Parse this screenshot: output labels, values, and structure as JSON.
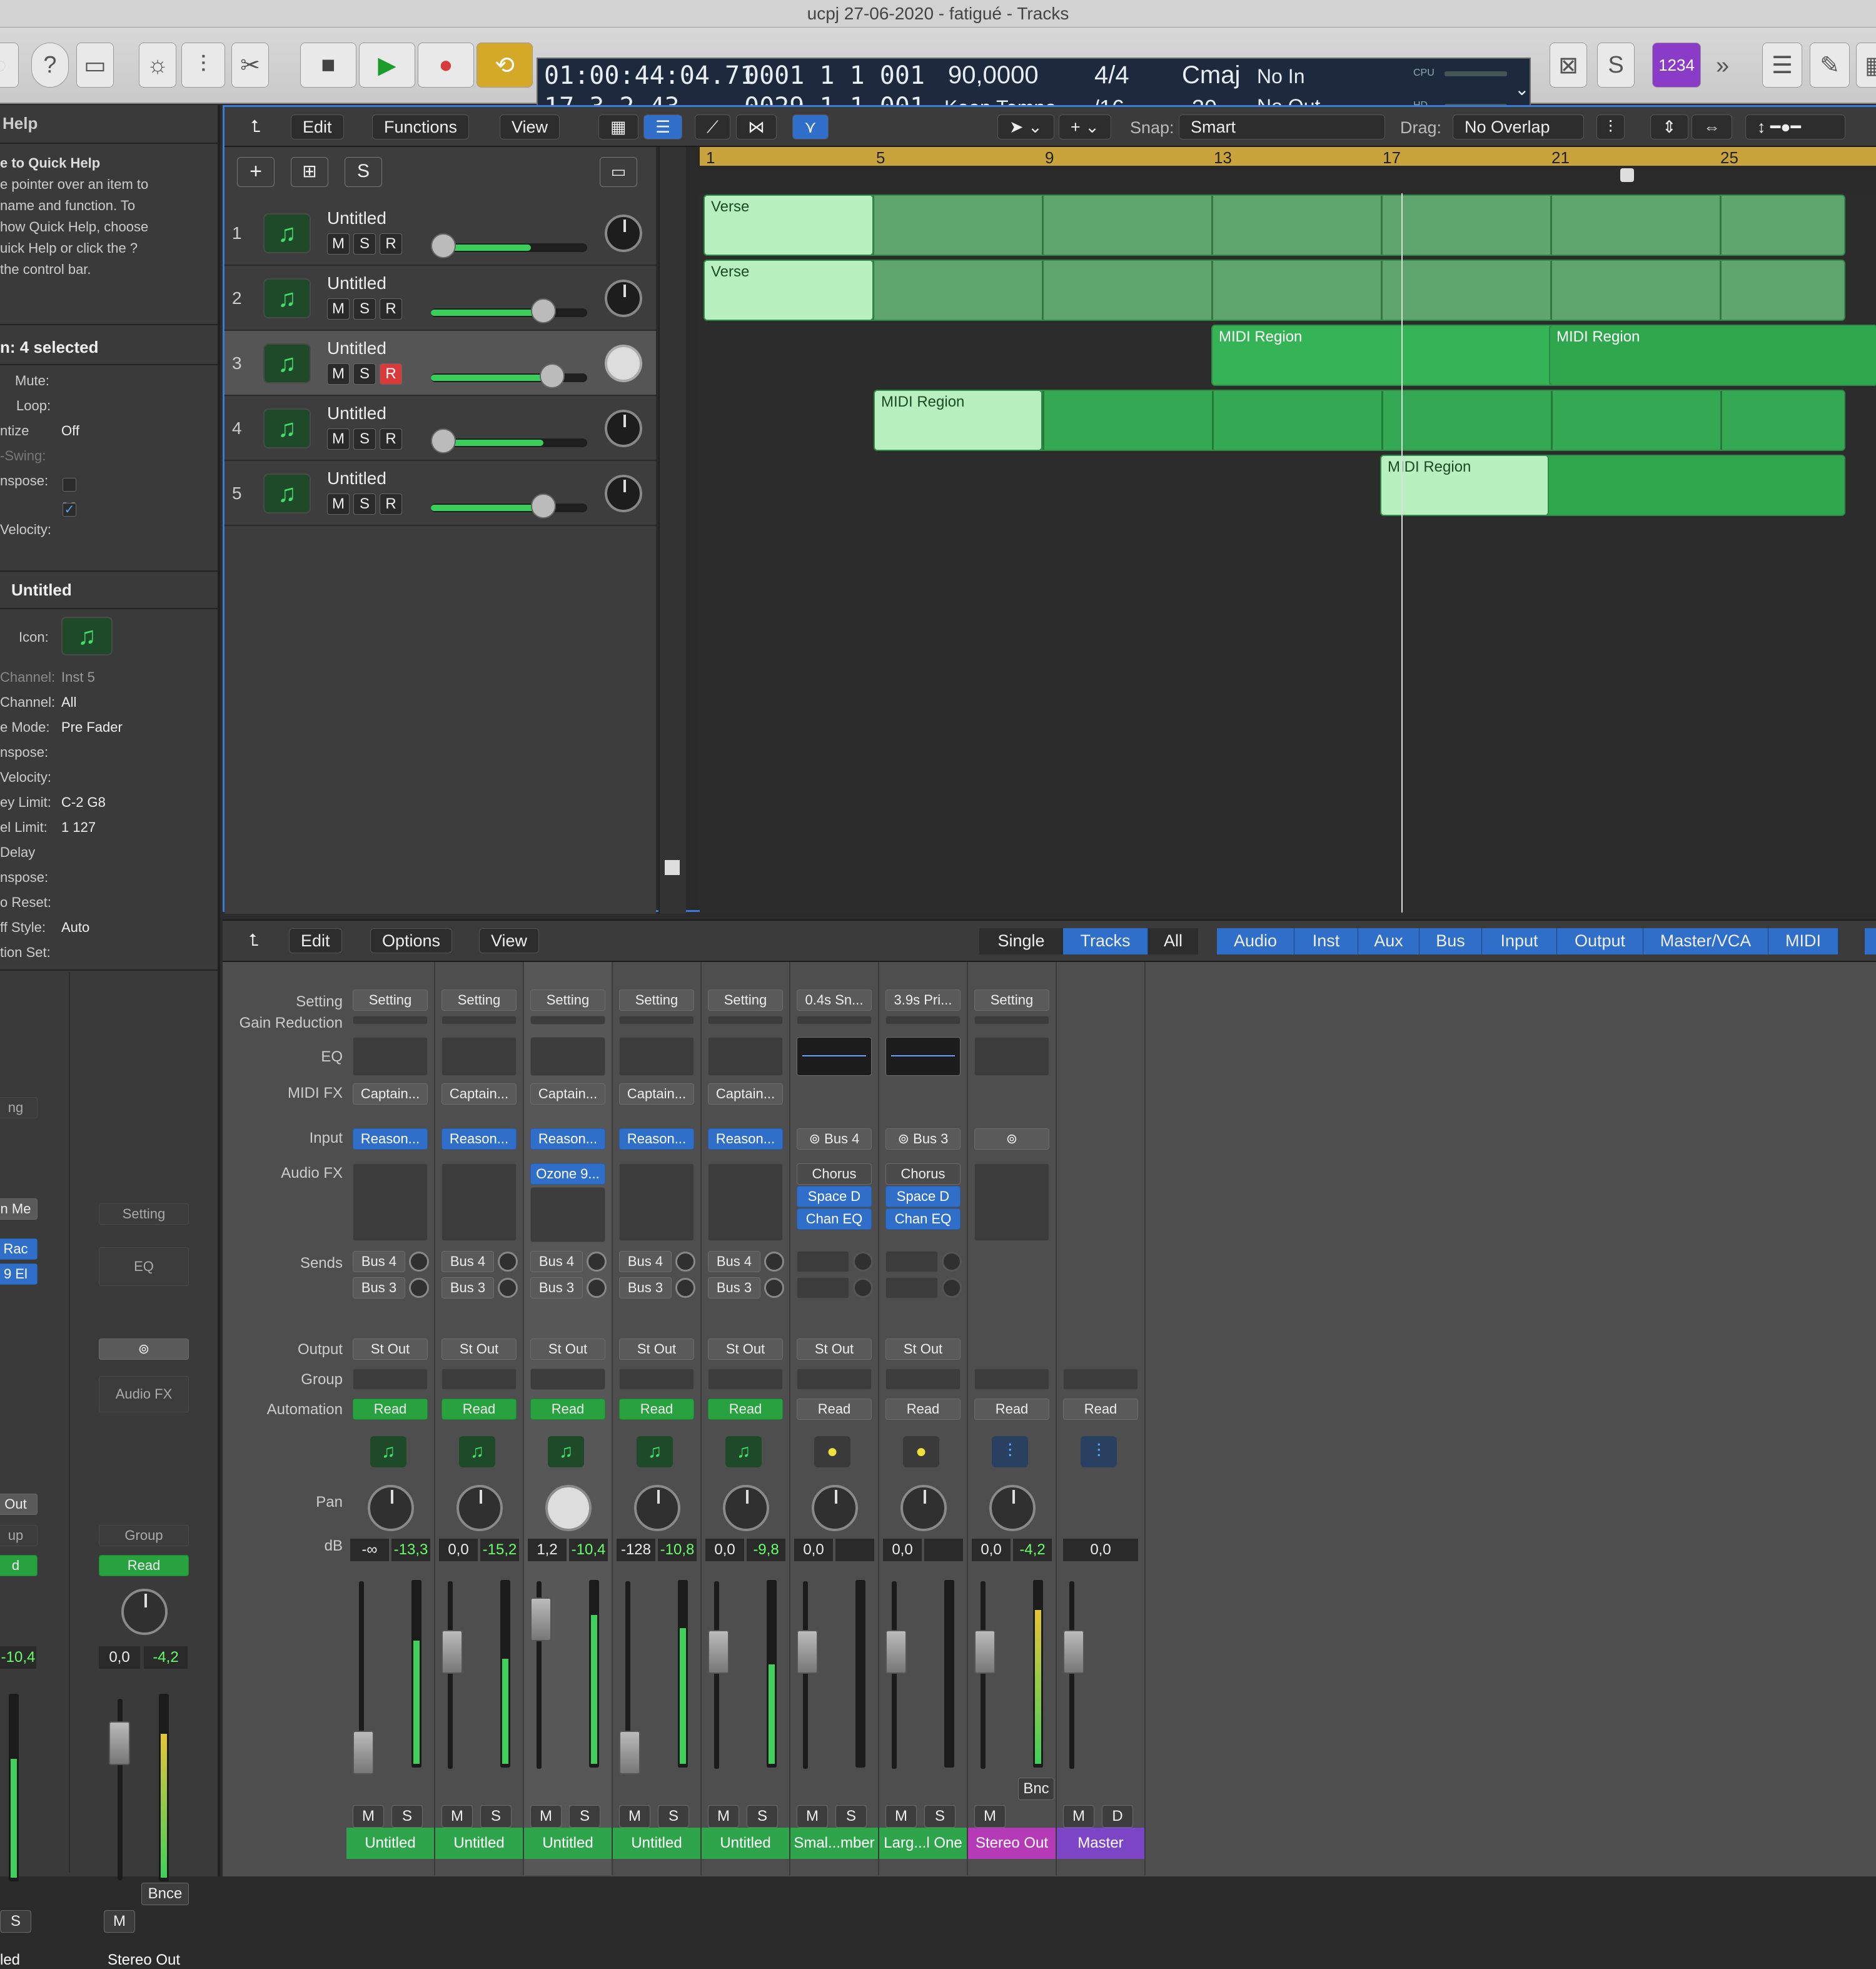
{
  "window": {
    "title": "ucpj 27-06-2020 - fatigué - Tracks"
  },
  "lcd": {
    "time": "01:00:44:04.71",
    "bars": "17  3  2  43",
    "pos_left": "0001  1  1  001",
    "pos_left_b": "0029  1  1  001",
    "tempo": "90,0000",
    "tempo_mode": "Keep Tempo",
    "sig_top": "4/4",
    "sig_bottom": "/16",
    "key": "Cmaj",
    "key_num": "30",
    "in": "No In",
    "out": "No Out",
    "cpu": "CPU",
    "hd": "HD"
  },
  "toolbar": {
    "counter_badge": "1234"
  },
  "inspector": {
    "help_title": "Help",
    "help_text": [
      "e to Quick Help",
      "e pointer over an item to",
      "name and function. To",
      "how Quick Help, choose",
      "uick Help or click the ?",
      "the control bar."
    ],
    "region_header": "n:  4 selected",
    "mute": "Mute:",
    "loop": "Loop:",
    "quantize": "ntize",
    "quantize_val": "Off",
    "swing": "-Swing:",
    "transpose": "nspose:",
    "transpose_val": "- -",
    "velocity": "Velocity:",
    "track_header": "Untitled",
    "icon": "Icon:",
    "midi_channel": "Channel:",
    "midi_channel_val": "Inst 5",
    "channel": "Channel:",
    "channel_val": "All",
    "mode": "e Mode:",
    "mode_val": "Pre Fader",
    "transpose2": "nspose:",
    "velocity2": "Velocity:",
    "key_limit": "ey Limit:",
    "key_limit_val": "C-2  G8",
    "vel_limit": "el Limit:",
    "vel_limit_val": "1   127",
    "delay": "Delay",
    "transpose3": "nspose:",
    "reset": "o Reset:",
    "style": "ff Style:",
    "style_val": "Auto",
    "set": "tion Set:"
  },
  "tracks_area": {
    "menus": [
      "Edit",
      "Functions",
      "View"
    ],
    "snap_label": "Snap:",
    "snap_val": "Smart",
    "drag_label": "Drag:",
    "drag_val": "No Overlap",
    "add": "+",
    "s_btn": "S",
    "ruler": [
      "1",
      "5",
      "9",
      "13",
      "17",
      "21",
      "25"
    ],
    "tracks": [
      {
        "num": "1",
        "name": "Untitled"
      },
      {
        "num": "2",
        "name": "Untitled"
      },
      {
        "num": "3",
        "name": "Untitled"
      },
      {
        "num": "4",
        "name": "Untitled"
      },
      {
        "num": "5",
        "name": "Untitled"
      }
    ],
    "regions": {
      "verse": "Verse",
      "midi": "MIDI Region"
    }
  },
  "mixer": {
    "menus": [
      "Edit",
      "Options",
      "View"
    ],
    "view_tabs": [
      "Single",
      "Tracks",
      "All"
    ],
    "filter_tabs": [
      "Audio",
      "Inst",
      "Aux",
      "Bus",
      "Input",
      "Output",
      "Master/VCA",
      "MIDI"
    ],
    "row_labels": [
      "Setting",
      "Gain Reduction",
      "EQ",
      "MIDI FX",
      "Input",
      "Audio FX",
      "Sends",
      "Output",
      "Group",
      "Automation",
      "Pan",
      "dB"
    ],
    "left_partial": {
      "setting": "ng",
      "s1": "n Me",
      "s2": "Rac",
      "s3": "9 El",
      "out": "Out",
      "grp": "up",
      "read": "d",
      "db": "-10,4",
      "s": "S",
      "name": "led"
    },
    "stereo_strip": {
      "setting": "Setting",
      "eq": "EQ",
      "audiofx": "Audio FX",
      "group": "Group",
      "read": "Read",
      "db1": "0,0",
      "db2": "-4,2",
      "bnce": "Bnce",
      "m": "M",
      "name": "Stereo Out"
    },
    "strips": [
      {
        "setting": "Setting",
        "midifx": "Captain...",
        "input": "Reason...",
        "fx": [],
        "sends": [
          "Bus 4",
          "Bus 3"
        ],
        "out": "St Out",
        "auto": "Read",
        "db1": "-∞",
        "db2": "-13,3",
        "name": "Untitled"
      },
      {
        "setting": "Setting",
        "midifx": "Captain...",
        "input": "Reason...",
        "fx": [],
        "sends": [
          "Bus 4",
          "Bus 3"
        ],
        "out": "St Out",
        "auto": "Read",
        "db1": "0,0",
        "db2": "-15,2",
        "name": "Untitled"
      },
      {
        "setting": "Setting",
        "midifx": "Captain...",
        "input": "Reason...",
        "fx": [
          "Ozone 9..."
        ],
        "sends": [
          "Bus 4",
          "Bus 3"
        ],
        "out": "St Out",
        "auto": "Read",
        "db1": "1,2",
        "db2": "-10,4",
        "name": "Untitled"
      },
      {
        "setting": "Setting",
        "midifx": "Captain...",
        "input": "Reason...",
        "fx": [],
        "sends": [
          "Bus 4",
          "Bus 3"
        ],
        "out": "St Out",
        "auto": "Read",
        "db1": "-128",
        "db2": "-10,8",
        "name": "Untitled"
      },
      {
        "setting": "Setting",
        "midifx": "Captain...",
        "input": "Reason...",
        "fx": [],
        "sends": [
          "Bus 4",
          "Bus 3"
        ],
        "out": "St Out",
        "auto": "Read",
        "db1": "0,0",
        "db2": "-9,8",
        "name": "Untitled"
      },
      {
        "setting": "0.4s Sn...",
        "midifx": "",
        "input": "Bus 4",
        "fx": [
          "Chorus",
          "Space D",
          "Chan EQ"
        ],
        "sends": [],
        "out": "St Out",
        "auto": "Read",
        "db1": "0,0",
        "db2": "",
        "name": "Smal...mber"
      },
      {
        "setting": "3.9s Pri...",
        "midifx": "",
        "input": "Bus 3",
        "fx": [
          "Chorus",
          "Space D",
          "Chan EQ"
        ],
        "sends": [],
        "out": "St Out",
        "auto": "Read",
        "db1": "0,0",
        "db2": "",
        "name": "Larg...l One"
      },
      {
        "setting": "Setting",
        "midifx": "",
        "input": "",
        "fx": [],
        "sends": [],
        "out": "",
        "auto": "Read",
        "db1": "0,0",
        "db2": "-4,2",
        "name": "Stereo Out",
        "bnc": "Bnc"
      },
      {
        "setting": "",
        "midifx": "",
        "input": "",
        "fx": [],
        "sends": [],
        "out": "",
        "auto": "Read",
        "db1": "0,0",
        "db2": "",
        "name": "Master"
      }
    ],
    "btn_m": "M",
    "btn_s": "S",
    "btn_d": "D"
  },
  "colors": {
    "accent_blue": "#2f6ec9",
    "region_green": "#34b454",
    "ruler_gold": "#c9a33b",
    "record_red": "#d93a3a",
    "stereo_magenta": "#b43ab8",
    "master_purple": "#7b45c6"
  }
}
